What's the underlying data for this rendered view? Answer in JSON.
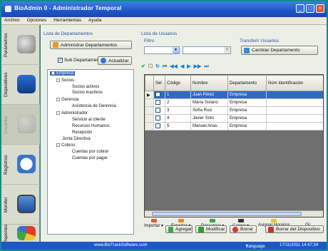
{
  "window": {
    "title": "BioAdmin 0 - Administrador Temporal"
  },
  "menu": [
    "Archivo",
    "Opciones",
    "Herramientas",
    "Ayuda"
  ],
  "nav": [
    {
      "label": "Parámetros",
      "icon": "gears-icon"
    },
    {
      "label": "Dispositivos",
      "icon": "devices-icon"
    },
    {
      "label": "Usuarios",
      "icon": "users-icon"
    },
    {
      "label": "Registros",
      "icon": "clock-icon"
    },
    {
      "label": "Monitor",
      "icon": "monitor-icon"
    },
    {
      "label": "Reportes",
      "icon": "chart-icon"
    }
  ],
  "departments": {
    "group_label": "Lista de Departamentos",
    "admin_button": "Administrar Departamentos",
    "sub_label": "Sub Departamentos",
    "refresh_button": "Actualizar",
    "tree": [
      {
        "label": "Empresa",
        "level": 0,
        "selected": true
      },
      {
        "label": "Socios",
        "level": 1
      },
      {
        "label": "Socios activos",
        "level": 2
      },
      {
        "label": "Socios inactivos",
        "level": 2
      },
      {
        "label": "Gerencia",
        "level": 1
      },
      {
        "label": "Asistencia de Gerencia",
        "level": 2
      },
      {
        "label": "Administrador",
        "level": 1
      },
      {
        "label": "Servicio al cliente",
        "level": 2
      },
      {
        "label": "Recursos Humanos",
        "level": 2
      },
      {
        "label": "Recepción",
        "level": 2
      },
      {
        "label": "Junta Directiva",
        "level": 1
      },
      {
        "label": "Cobros",
        "level": 1
      },
      {
        "label": "Cuentas por cobrar",
        "level": 2
      },
      {
        "label": "Cuentas por pagar",
        "level": 2
      }
    ]
  },
  "users": {
    "group_label": "Lista de Usuarios",
    "filter_label": "Filtro",
    "transfer_label": "Transferir Usuarios",
    "change_dept_button": "Cambiar Departamento",
    "columns": [
      "Sel",
      "Código",
      "Nombre",
      "Departamento",
      "Núm Identificación"
    ],
    "rows": [
      {
        "code": "1",
        "name": "Juan Pérez",
        "dept": "Empresa",
        "selected": true
      },
      {
        "code": "2",
        "name": "María Solano",
        "dept": "Empresa"
      },
      {
        "code": "3",
        "name": "Sofía Ruiz",
        "dept": "Empresa"
      },
      {
        "code": "4",
        "name": "Javier Soto",
        "dept": "Empresa"
      },
      {
        "code": "5",
        "name": "Manuel Arias",
        "dept": "Empresa"
      }
    ],
    "count": "(5)"
  },
  "actions": [
    "Importar",
    "Exportar",
    "Descargar",
    "Cargar",
    "Asignar Horarios"
  ],
  "buttons": {
    "add": "Agregar",
    "modify": "Modificar",
    "delete": "Borrar",
    "delete_device": "Borrar del Dispositivo"
  },
  "status": {
    "url": "www.BioTrackSoftware.com",
    "language": "Language",
    "datetime": "17/11/2011 14:47:34"
  },
  "colors": {
    "titlebar": "#1d56c8",
    "selection": "#316ac5",
    "frame": "#0f8d87"
  }
}
